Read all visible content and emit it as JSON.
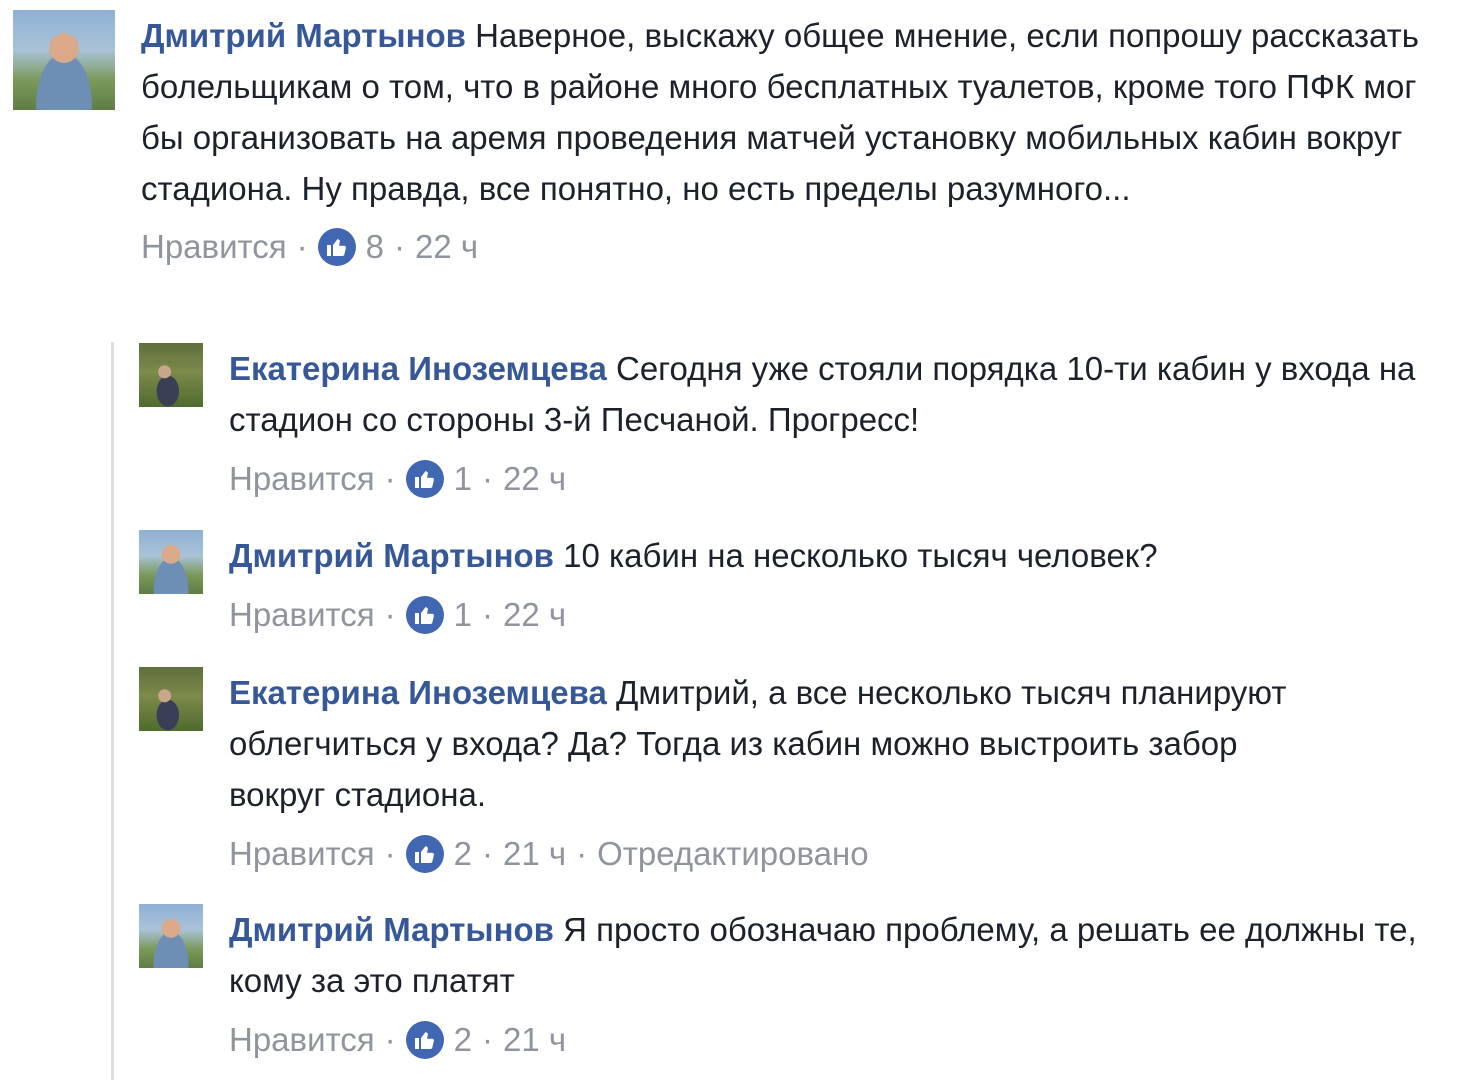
{
  "comments": [
    {
      "author": "Дмитрий Мартынов",
      "text": "Наверное, выскажу общее мнение, если попрошу рассказать болельщикам о том, что в районе много бесплатных туалетов, кроме того ПФК мог бы организовать на аремя проведения матчей установку мобильных кабин вокруг стадиона. Ну правда, все понятно, но есть пределы разумного...",
      "like_label": "Нравится",
      "likes": "8",
      "time": "22 ч"
    }
  ],
  "replies": [
    {
      "author": "Екатерина Иноземцева",
      "text": "Сегодня уже стояли порядка 10-ти кабин у входа на стадион со стороны 3-й Песчаной. Прогресс!",
      "like_label": "Нравится",
      "likes": "1",
      "time": "22 ч"
    },
    {
      "author": "Дмитрий Мартынов",
      "text": "10 кабин на несколько тысяч человек?",
      "like_label": "Нравится",
      "likes": "1",
      "time": "22 ч"
    },
    {
      "author": "Екатерина Иноземцева",
      "text": "Дмитрий, а все несколько тысяч планируют облегчиться у входа? Да? Тогда из кабин можно выстроить забор вокруг стадиона.",
      "like_label": "Нравится",
      "likes": "2",
      "time": "21 ч",
      "edited": "Отредактировано"
    },
    {
      "author": "Дмитрий Мартынов",
      "text": "Я просто обозначаю проблему, а решать ее должны те, кому за это платят",
      "like_label": "Нравится",
      "likes": "2",
      "time": "21 ч"
    }
  ],
  "separator": "·",
  "colors": {
    "name": "#365899",
    "meta": "#90949c",
    "like_badge": "#4267b2"
  },
  "icons": {
    "like": "thumbs-up-icon"
  }
}
